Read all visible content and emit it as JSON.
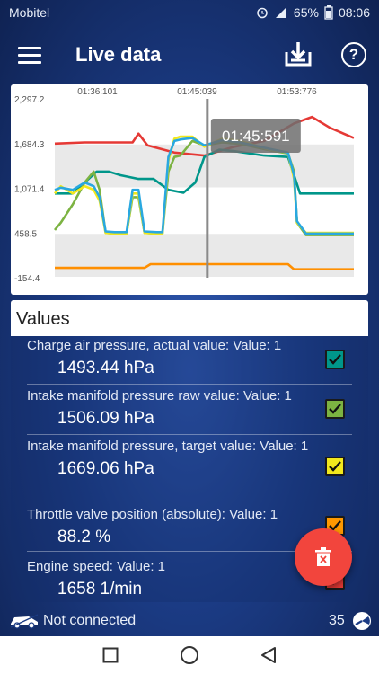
{
  "status_bar": {
    "carrier": "Mobitel",
    "battery": "65%",
    "time": "08:06",
    "icons": [
      "alarm-icon",
      "signal-icon",
      "battery-icon"
    ]
  },
  "app_bar": {
    "title": "Live data",
    "icons": [
      "menu-icon",
      "download-icon",
      "help-icon"
    ],
    "help_glyph": "?"
  },
  "chart": {
    "crosshair_label": "01:45:591",
    "colors": {
      "red": "#e53935",
      "teal": "#00968a",
      "green": "#7cb342",
      "yellow": "#f2e81c",
      "blue": "#29a8e0",
      "orange": "#ff8f00",
      "crosshair": "#8a8a8a"
    }
  },
  "chart_data": {
    "type": "line",
    "title": "",
    "xlabel": "",
    "ylabel": "",
    "x_ticks": [
      "01:36:101",
      "01:45:039",
      "01:53:776"
    ],
    "y_ticks": [
      "2,297.2",
      "1,684.3",
      "1,071.4",
      "458.5",
      "-154.4"
    ],
    "ylim": [
      -154.4,
      2297.2
    ],
    "grid": true,
    "legend": "none",
    "series": [
      {
        "color": "red",
        "x": [
          0,
          0.1,
          0.2,
          0.26,
          0.28,
          0.31,
          0.4,
          0.5,
          0.6,
          0.7,
          0.8,
          0.86,
          0.92,
          1.0
        ],
        "values": [
          1684,
          1700,
          1700,
          1700,
          1820,
          1660,
          1560,
          1520,
          1640,
          1720,
          1960,
          2050,
          1900,
          1760
        ]
      },
      {
        "color": "teal",
        "x": [
          0,
          0.06,
          0.1,
          0.14,
          0.18,
          0.22,
          0.28,
          0.33,
          0.38,
          0.43,
          0.47,
          0.5,
          0.55,
          0.6,
          0.7,
          0.78,
          0.82,
          0.88,
          1.0
        ],
        "values": [
          1000,
          1000,
          1150,
          1300,
          1300,
          1250,
          1200,
          1200,
          1050,
          1010,
          1150,
          1500,
          1600,
          1580,
          1520,
          1500,
          1000,
          1000,
          1000
        ]
      },
      {
        "color": "green",
        "x": [
          0,
          0.02,
          0.06,
          0.1,
          0.13,
          0.15,
          0.17,
          0.2,
          0.24,
          0.26,
          0.28,
          0.3,
          0.34,
          0.36,
          0.38,
          0.4,
          0.42,
          0.46,
          0.5,
          0.56,
          0.62,
          0.72,
          0.78,
          0.8,
          0.81,
          0.84,
          1.0
        ],
        "values": [
          500,
          600,
          850,
          1150,
          1300,
          1050,
          460,
          450,
          450,
          950,
          950,
          460,
          450,
          450,
          1300,
          1500,
          1520,
          1720,
          1660,
          1700,
          1680,
          1590,
          1550,
          1300,
          600,
          430,
          430
        ]
      },
      {
        "color": "yellow",
        "x": [
          0,
          0.02,
          0.06,
          0.1,
          0.13,
          0.15,
          0.17,
          0.2,
          0.24,
          0.26,
          0.28,
          0.3,
          0.34,
          0.36,
          0.38,
          0.4,
          0.42,
          0.46,
          0.5,
          0.56,
          0.62,
          0.72,
          0.78,
          0.8,
          0.81,
          0.84,
          1.0
        ],
        "values": [
          1000,
          1100,
          1000,
          1100,
          1050,
          900,
          460,
          450,
          450,
          1000,
          1000,
          460,
          450,
          450,
          1450,
          1750,
          1780,
          1780,
          1640,
          1750,
          1720,
          1600,
          1560,
          1200,
          600,
          460,
          460
        ]
      },
      {
        "color": "blue",
        "x": [
          0,
          0.02,
          0.06,
          0.1,
          0.13,
          0.15,
          0.17,
          0.2,
          0.24,
          0.26,
          0.28,
          0.3,
          0.34,
          0.36,
          0.38,
          0.4,
          0.42,
          0.46,
          0.5,
          0.56,
          0.62,
          0.72,
          0.78,
          0.8,
          0.81,
          0.84,
          1.0
        ],
        "values": [
          1050,
          1080,
          1050,
          1150,
          1100,
          950,
          480,
          470,
          470,
          1050,
          1050,
          480,
          470,
          470,
          1500,
          1720,
          1740,
          1760,
          1660,
          1730,
          1700,
          1610,
          1560,
          1250,
          620,
          450,
          450
        ]
      },
      {
        "color": "orange",
        "x": [
          0,
          0.2,
          0.3,
          0.32,
          0.6,
          0.78,
          0.8,
          1.0
        ],
        "values": [
          -20,
          -20,
          -20,
          30,
          30,
          30,
          -40,
          -40
        ]
      }
    ],
    "crosshair_x": 0.51
  },
  "values_panel": {
    "header": "Values",
    "items": [
      {
        "label": "Charge air pressure, actual value: Value: 1",
        "value": "1493.44 hPa",
        "color": "#00968a",
        "checked": true
      },
      {
        "label": "Intake manifold pressure raw value: Value: 1",
        "value": "1506.09 hPa",
        "color": "#7cb342",
        "checked": true
      },
      {
        "label": "Intake manifold pressure, target value: Value: 1",
        "value": "1669.06 hPa",
        "color": "#f2e81c",
        "checked": true
      },
      {
        "label": "Throttle valve position (absolute): Value: 1",
        "value": "88.2 %",
        "color": "#ff9800",
        "checked": true
      },
      {
        "label": "Engine speed: Value: 1",
        "value": "1658 1/min",
        "color": "#e53935",
        "checked": true
      }
    ]
  },
  "fab": {
    "icon": "delete-icon",
    "color": "#f2453d"
  },
  "bottom_status": {
    "connection": "Not connected",
    "count": "35",
    "icons": [
      "car-icon",
      "gauge-icon"
    ]
  },
  "nav_bar": {
    "icons": [
      "recents-icon",
      "home-icon",
      "back-icon"
    ]
  }
}
